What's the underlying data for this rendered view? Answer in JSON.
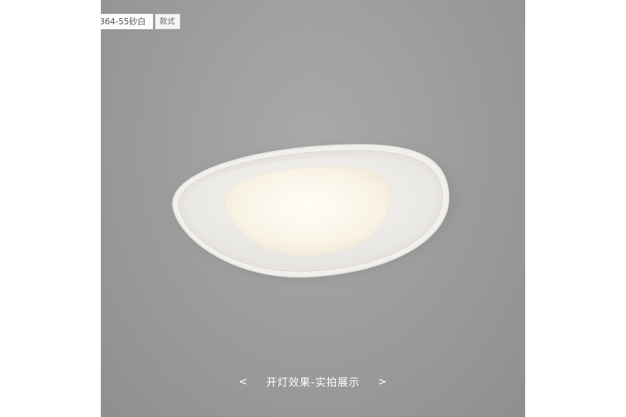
{
  "product_tag": {
    "model_label": "364-55砂白",
    "style_label": "款式"
  },
  "caption": {
    "text": "开灯效果-实拍展示",
    "prev_icon": "chevron-left-icon",
    "next_icon": "chevron-right-icon",
    "prev_glyph": "<",
    "next_glyph": ">"
  },
  "colors": {
    "ceiling": "#9e9e9e",
    "lamp_frame": "#f3f3f3",
    "lamp_glow": "#fdf8ee",
    "caption_text": "#ffffff"
  }
}
